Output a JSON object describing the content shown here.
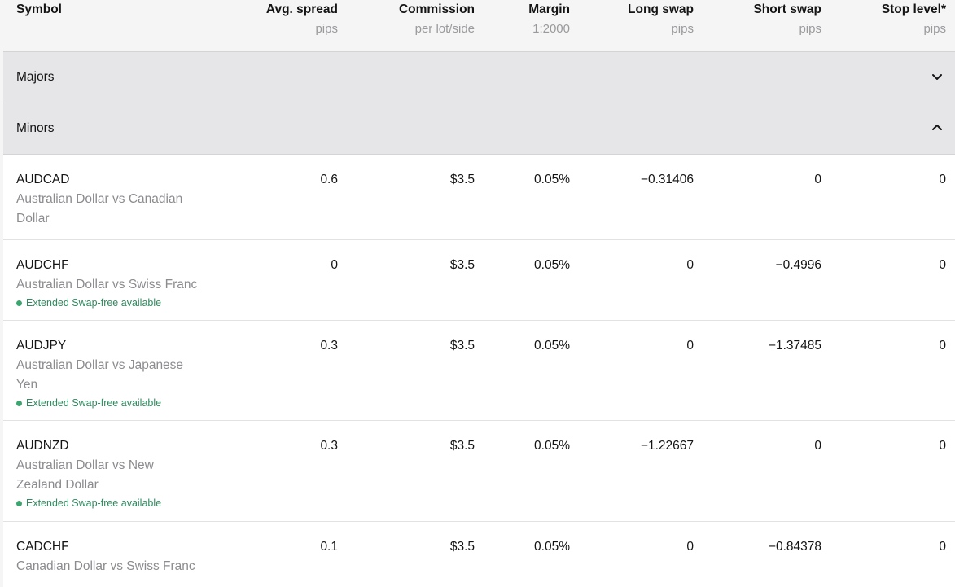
{
  "columns": [
    {
      "title": "Symbol",
      "sub": ""
    },
    {
      "title": "Avg. spread",
      "sub": "pips"
    },
    {
      "title": "Commission",
      "sub": "per lot/side"
    },
    {
      "title": "Margin",
      "sub": "1:2000"
    },
    {
      "title": "Long swap",
      "sub": "pips"
    },
    {
      "title": "Short swap",
      "sub": "pips"
    },
    {
      "title": "Stop level*",
      "sub": "pips"
    }
  ],
  "groups": {
    "majors": {
      "label": "Majors",
      "expanded": false
    },
    "minors": {
      "label": "Minors",
      "expanded": true
    }
  },
  "rows": [
    {
      "symbol": "AUDCAD",
      "desc_lines": [
        "Australian Dollar vs Canadian",
        "Dollar"
      ],
      "badge": "",
      "spread": "0.6",
      "commission": "$3.5",
      "margin": "0.05%",
      "long_swap": "−0.31406",
      "short_swap": "0",
      "stop_level": "0"
    },
    {
      "symbol": "AUDCHF",
      "desc_lines": [
        "Australian Dollar vs Swiss Franc"
      ],
      "badge": "Extended Swap-free available",
      "spread": "0",
      "commission": "$3.5",
      "margin": "0.05%",
      "long_swap": "0",
      "short_swap": "−0.4996",
      "stop_level": "0"
    },
    {
      "symbol": "AUDJPY",
      "desc_lines": [
        "Australian Dollar vs Japanese",
        "Yen"
      ],
      "badge": "Extended Swap-free available",
      "spread": "0.3",
      "commission": "$3.5",
      "margin": "0.05%",
      "long_swap": "0",
      "short_swap": "−1.37485",
      "stop_level": "0"
    },
    {
      "symbol": "AUDNZD",
      "desc_lines": [
        "Australian Dollar vs New",
        "Zealand Dollar"
      ],
      "badge": "Extended Swap-free available",
      "spread": "0.3",
      "commission": "$3.5",
      "margin": "0.05%",
      "long_swap": "−1.22667",
      "short_swap": "0",
      "stop_level": "0"
    },
    {
      "symbol": "CADCHF",
      "desc_lines": [
        "Canadian Dollar vs Swiss Franc"
      ],
      "badge": "",
      "spread": "0.1",
      "commission": "$3.5",
      "margin": "0.05%",
      "long_swap": "0",
      "short_swap": "−0.84378",
      "stop_level": "0"
    }
  ],
  "colors": {
    "header_bg": "#f5f5f6",
    "group_bg": "#e6e6e8",
    "muted_text": "#8c8c90",
    "badge_green": "#2f8a5e"
  },
  "icons": {
    "collapsed": "chevron-down-icon",
    "expanded": "chevron-up-icon"
  }
}
